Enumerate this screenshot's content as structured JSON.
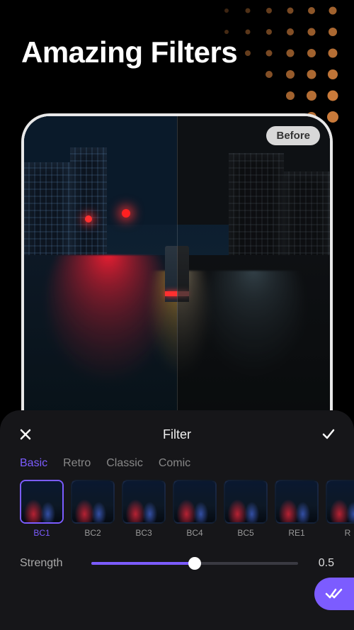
{
  "page_title": "Amazing Filters",
  "before_label": "Before",
  "panel": {
    "title": "Filter",
    "tabs": [
      "Basic",
      "Retro",
      "Classic",
      "Comic"
    ],
    "active_tab": 0,
    "thumbs": [
      {
        "label": "BC1",
        "active": true
      },
      {
        "label": "BC2",
        "active": false
      },
      {
        "label": "BC3",
        "active": false
      },
      {
        "label": "BC4",
        "active": false
      },
      {
        "label": "BC5",
        "active": false
      },
      {
        "label": "RE1",
        "active": false
      },
      {
        "label": "R",
        "active": false
      }
    ],
    "strength": {
      "label": "Strength",
      "value": "0.5",
      "fraction": 0.5
    }
  },
  "colors": {
    "accent": "#7c5cff",
    "panel_bg": "#161619",
    "dot_orange": "#c97a3a"
  },
  "icons": {
    "close": "close-icon",
    "confirm": "check-icon",
    "apply": "double-check-icon"
  }
}
